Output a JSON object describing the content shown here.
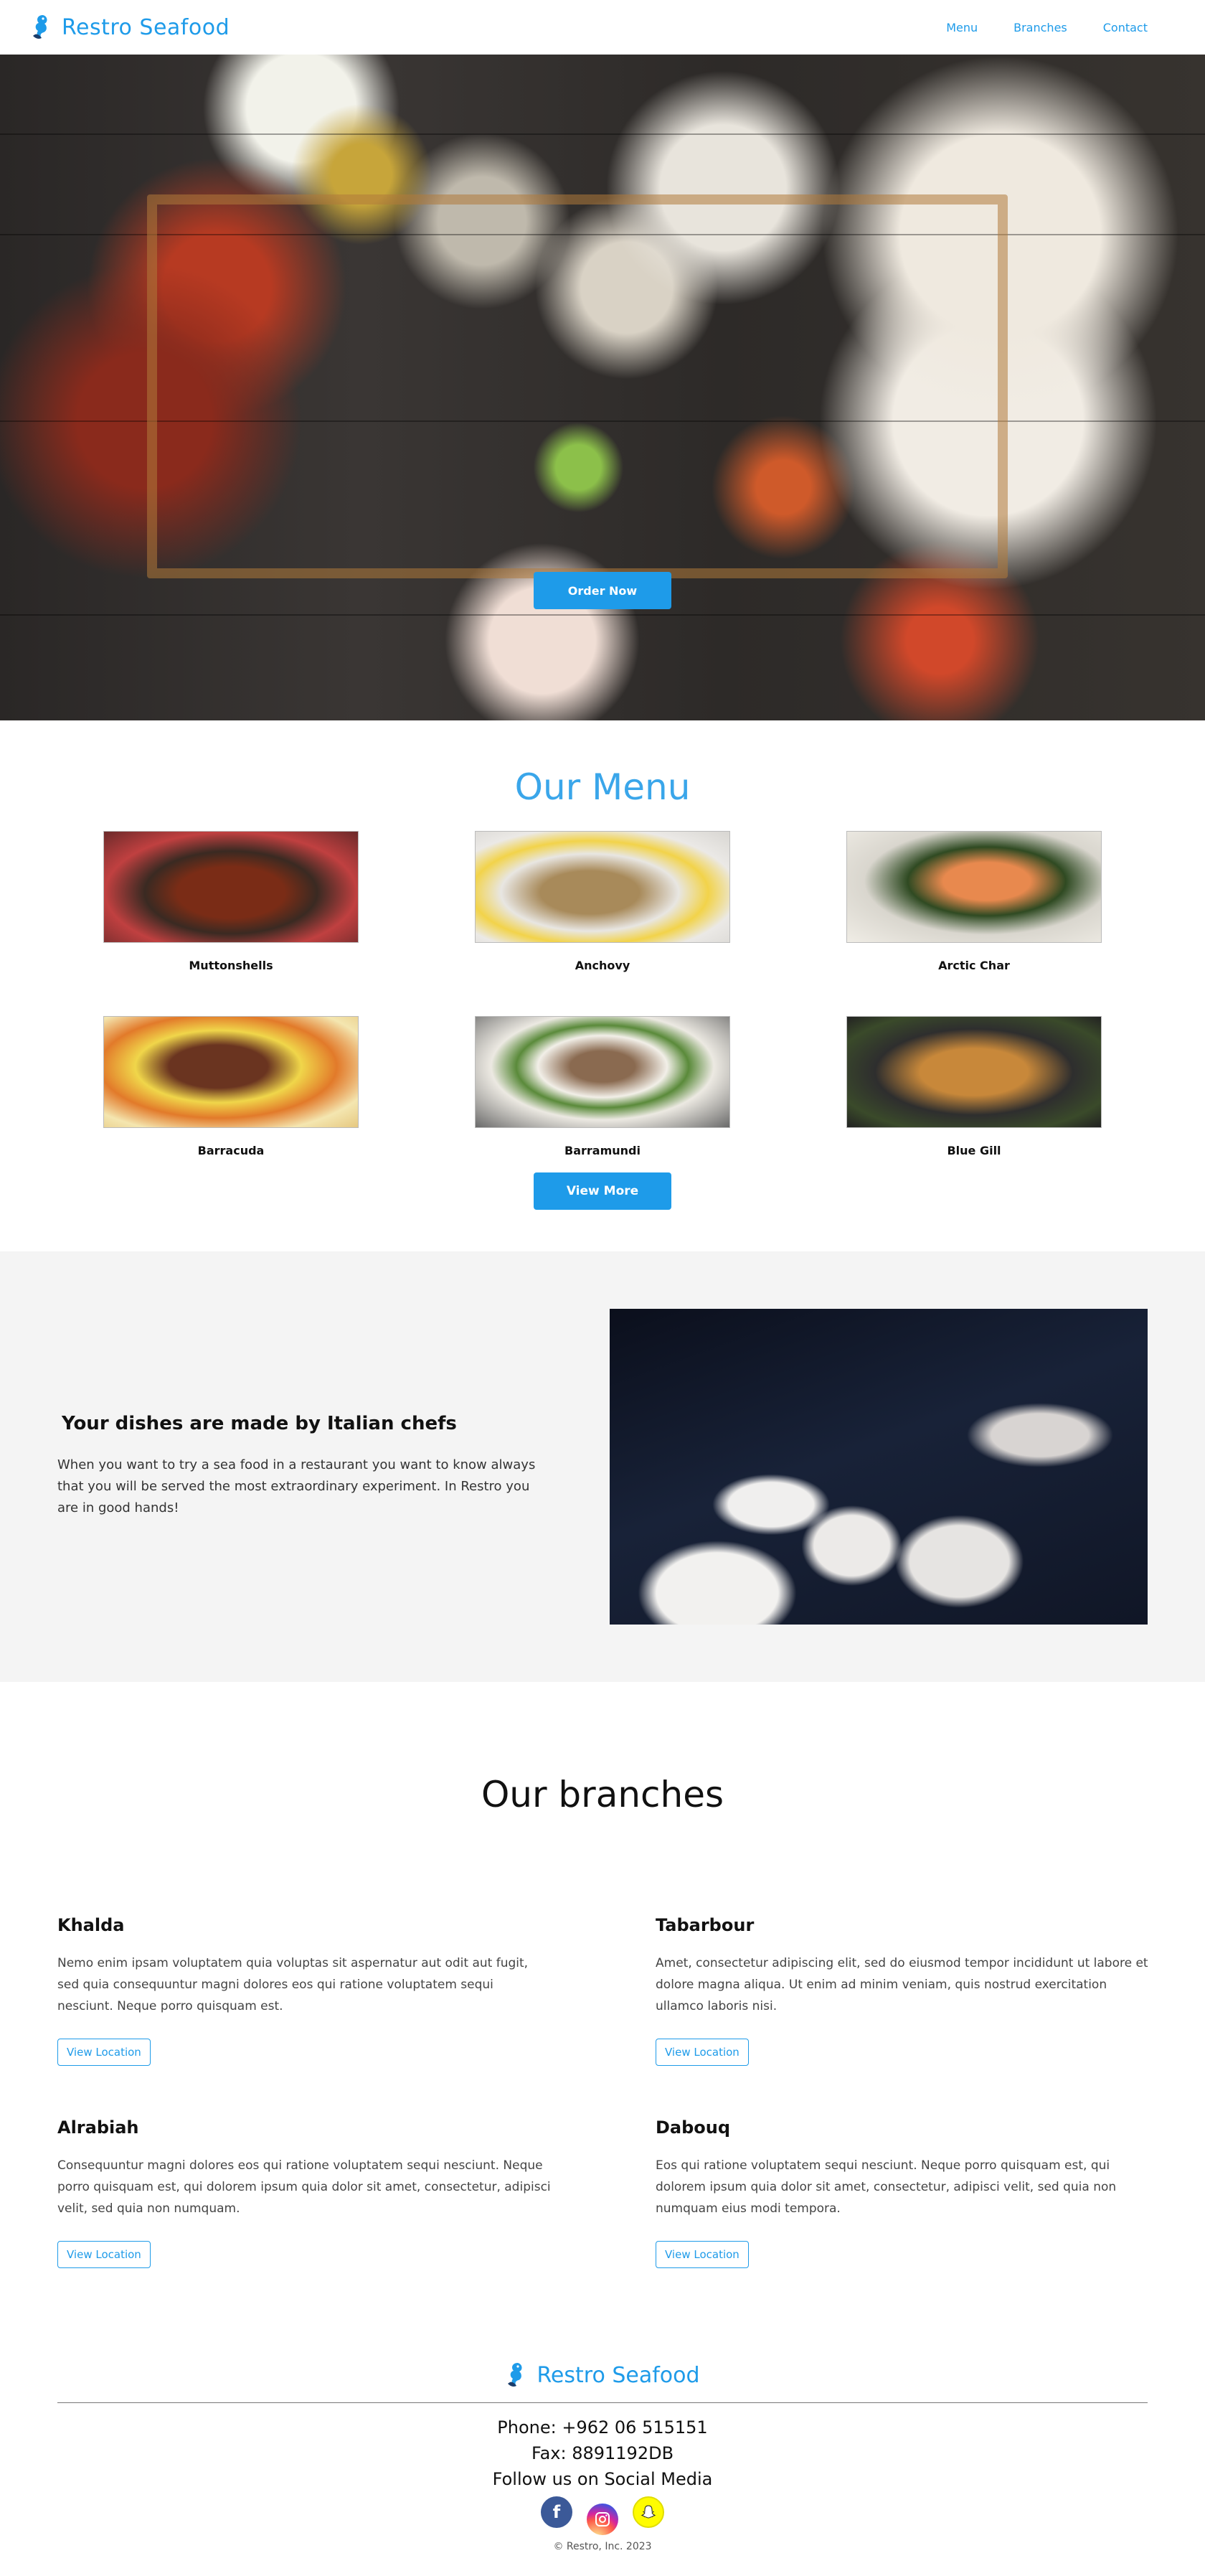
{
  "header": {
    "brand": "Restro Seafood",
    "nav": [
      "Menu",
      "Branches",
      "Contact"
    ]
  },
  "hero": {
    "order_button": "Order Now"
  },
  "menu": {
    "title": "Our Menu",
    "items": [
      {
        "name": "Muttonshells"
      },
      {
        "name": "Anchovy"
      },
      {
        "name": "Arctic Char"
      },
      {
        "name": "Barracuda"
      },
      {
        "name": "Barramundi"
      },
      {
        "name": "Blue Gill"
      }
    ],
    "view_more": "View More"
  },
  "chefs": {
    "title": "Your dishes are made by Italian chefs",
    "text": "When you want to try a sea food in a restaurant you want to know always that you will be served the most extraordinary experiment. In Restro you are in good hands!"
  },
  "branches": {
    "title": "Our branches",
    "items": [
      {
        "name": "Khalda",
        "text": "Nemo enim ipsam voluptatem quia voluptas sit aspernatur aut odit aut fugit, sed quia consequuntur magni dolores eos qui ratione voluptatem sequi nesciunt. Neque porro quisquam est.",
        "button": "View Location"
      },
      {
        "name": "Tabarbour",
        "text": "Amet, consectetur adipiscing elit, sed do eiusmod tempor incididunt ut labore et dolore magna aliqua. Ut enim ad minim veniam, quis nostrud exercitation ullamco laboris nisi.",
        "button": "View Location"
      },
      {
        "name": "Alrabiah",
        "text": "Consequuntur magni dolores eos qui ratione voluptatem sequi nesciunt. Neque porro quisquam est, qui dolorem ipsum quia dolor sit amet, consectetur, adipisci velit, sed quia non numquam.",
        "button": "View Location"
      },
      {
        "name": "Dabouq",
        "text": "Eos qui ratione voluptatem sequi nesciunt. Neque porro quisquam est, qui dolorem ipsum quia dolor sit amet, consectetur, adipisci velit, sed quia non numquam eius modi tempora.",
        "button": "View Location"
      }
    ]
  },
  "footer": {
    "brand": "Restro Seafood",
    "phone": "Phone: +962 06 515151",
    "fax": "Fax: 8891192DB",
    "follow": "Follow us on Social Media",
    "socials": [
      "facebook-icon",
      "instagram-icon",
      "snapchat-icon"
    ],
    "copyright": "© Restro, Inc. 2023"
  },
  "colors": {
    "accent": "#1e9be9",
    "section_bg": "#f4f4f4"
  }
}
